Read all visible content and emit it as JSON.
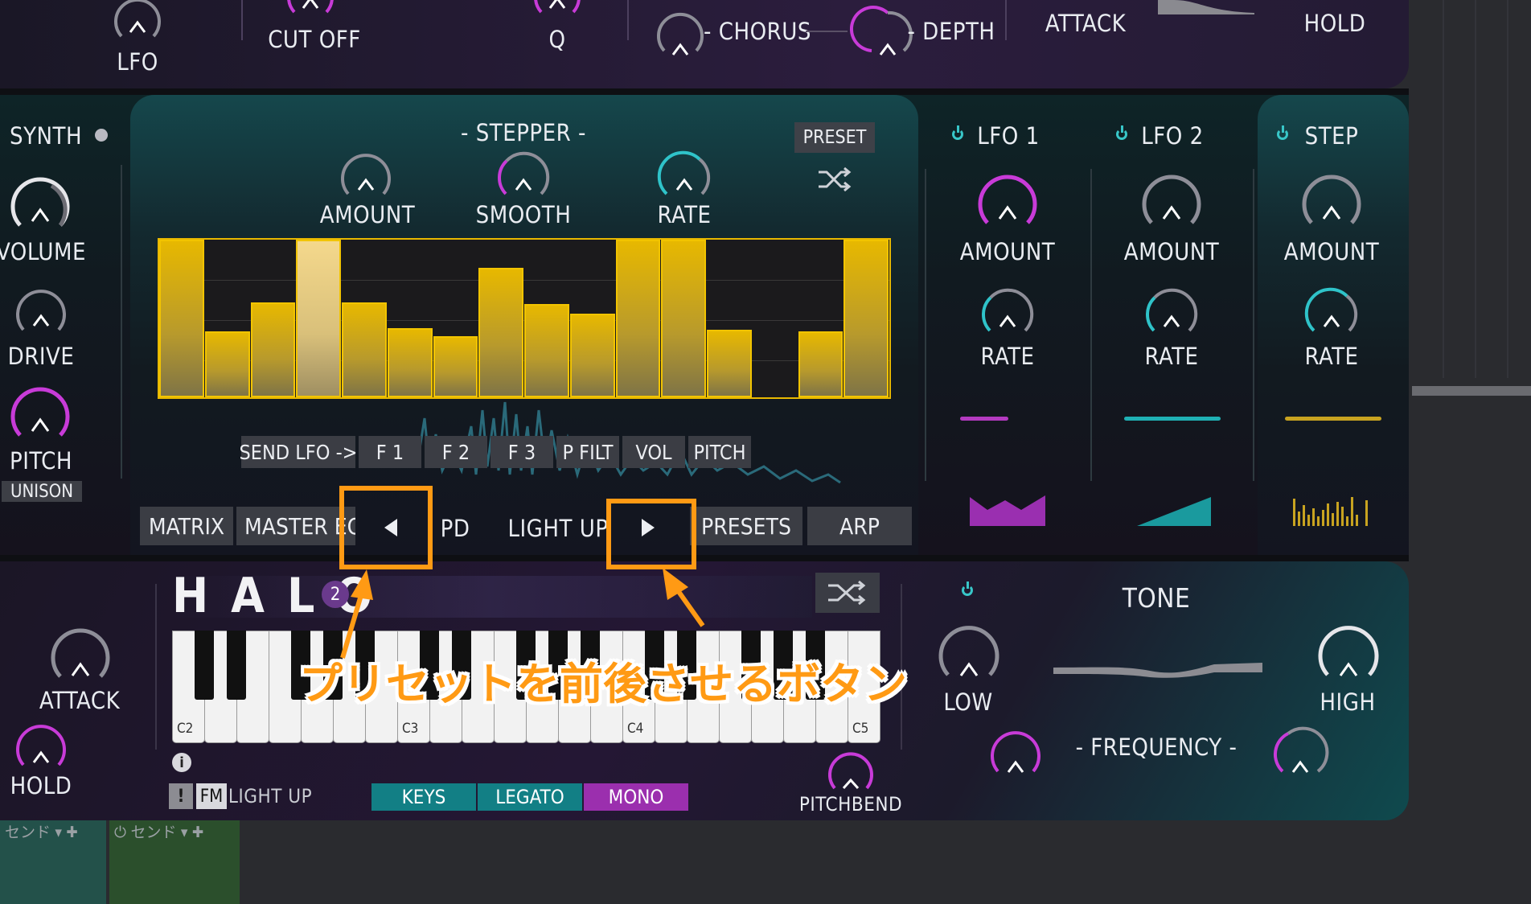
{
  "top_row": {
    "lfo": "LFO",
    "cutoff": "CUT OFF",
    "q": "Q",
    "chorus": "- CHORUS",
    "depth": "- DEPTH",
    "attack": "ATTACK",
    "hold": "HOLD"
  },
  "synth": {
    "title": "SYNTH",
    "volume": "VOLUME",
    "drive": "DRIVE",
    "pitch": "PITCH",
    "unison": "UNISON"
  },
  "stepper": {
    "title": "- STEPPER -",
    "preset": "PRESET",
    "amount": "AMOUNT",
    "smooth": "SMOOTH",
    "rate": "RATE",
    "steps": [
      1.0,
      0.42,
      0.6,
      1.0,
      0.6,
      0.44,
      0.39,
      0.82,
      0.59,
      0.53,
      1.0,
      1.0,
      0.43,
      0,
      0.42,
      1.0
    ],
    "highlight_step": 4,
    "send_lfo": "SEND LFO ->",
    "targets": [
      "F 1",
      "F 2",
      "F 3",
      "P FILT",
      "VOL",
      "PITCH"
    ]
  },
  "mod": {
    "lfo1": {
      "title": "LFO 1",
      "amount": "AMOUNT",
      "rate": "RATE",
      "color": "#b43ac0"
    },
    "lfo2": {
      "title": "LFO 2",
      "amount": "AMOUNT",
      "rate": "RATE",
      "color": "#1fb0b4"
    },
    "step": {
      "title": "STEP",
      "amount": "AMOUNT",
      "rate": "RATE",
      "color": "#c8a320"
    }
  },
  "nav": {
    "matrix": "MATRIX",
    "master_eq": "MASTER EQ",
    "preset_name": "PD",
    "light_up": "LIGHT UP",
    "presets": "PRESETS",
    "arp": "ARP"
  },
  "bottom": {
    "attack": "ATTACK",
    "hold": "HOLD",
    "logo": "HALO",
    "logo_badge": "2",
    "octaves": [
      "C2",
      "C3",
      "C4",
      "C5"
    ],
    "excl": "!",
    "fm": "FM",
    "light_up": "LIGHT UP",
    "modes": [
      "KEYS",
      "LEGATO",
      "MONO"
    ],
    "pitchbend": "PITCHBEND"
  },
  "tone": {
    "title": "TONE",
    "low": "LOW",
    "high": "HIGH",
    "frequency": "- FREQUENCY -"
  },
  "daw": {
    "send1": "センド ▾ ✚",
    "send2": "⏻ センド ▾ ✚"
  },
  "annotation": {
    "text": "プリセットを前後させるボタン",
    "color": "#ff9a14"
  },
  "colors": {
    "magenta": "#c83bd8",
    "teal": "#2fc3c9",
    "gold": "#e8b800"
  }
}
